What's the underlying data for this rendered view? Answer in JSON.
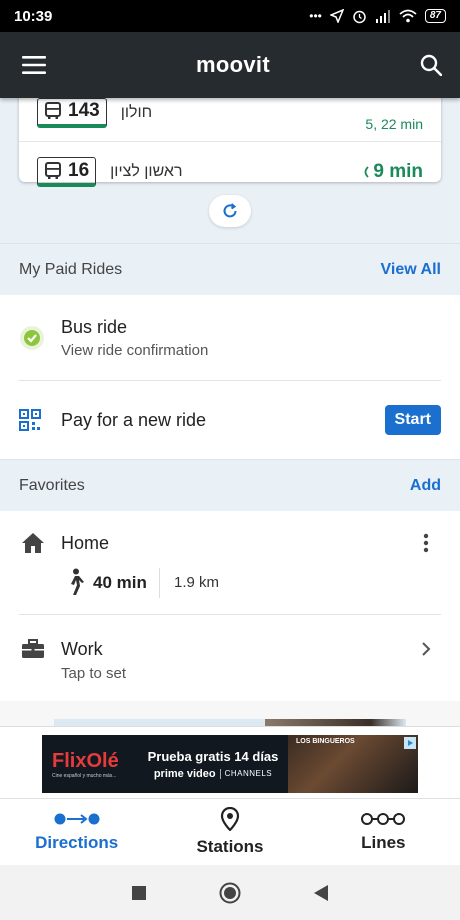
{
  "status_bar": {
    "time": "10:39",
    "battery": "87"
  },
  "app_bar": {
    "title": "moovit"
  },
  "lines": [
    {
      "number": "143",
      "destination": "חולון",
      "eta": "5, 22 min"
    },
    {
      "number": "16",
      "destination": "ראשון לציון",
      "eta": "9 min"
    }
  ],
  "paid_rides": {
    "header": "My Paid Rides",
    "view_all": "View All",
    "bus_ride_title": "Bus ride",
    "bus_ride_sub": "View ride confirmation",
    "pay_title": "Pay for a new ride",
    "start_label": "Start"
  },
  "favorites": {
    "header": "Favorites",
    "add": "Add",
    "home_title": "Home",
    "home_walk": "40 min",
    "home_distance": "1.9 km",
    "work_title": "Work",
    "work_sub": "Tap to set"
  },
  "ad": {
    "brand": "FlixOlé",
    "brand_tagline": "Cine español y mucho más...",
    "headline": "Prueba gratis 14 días",
    "prime": "prime video",
    "channels": "CHANNELS",
    "show": "LOS BINGUEROS"
  },
  "bottom_nav": {
    "directions": "Directions",
    "stations": "Stations",
    "lines": "Lines"
  },
  "colors": {
    "accent": "#1a6fcf",
    "green": "#1b8a5a",
    "appbar": "#262b30"
  }
}
